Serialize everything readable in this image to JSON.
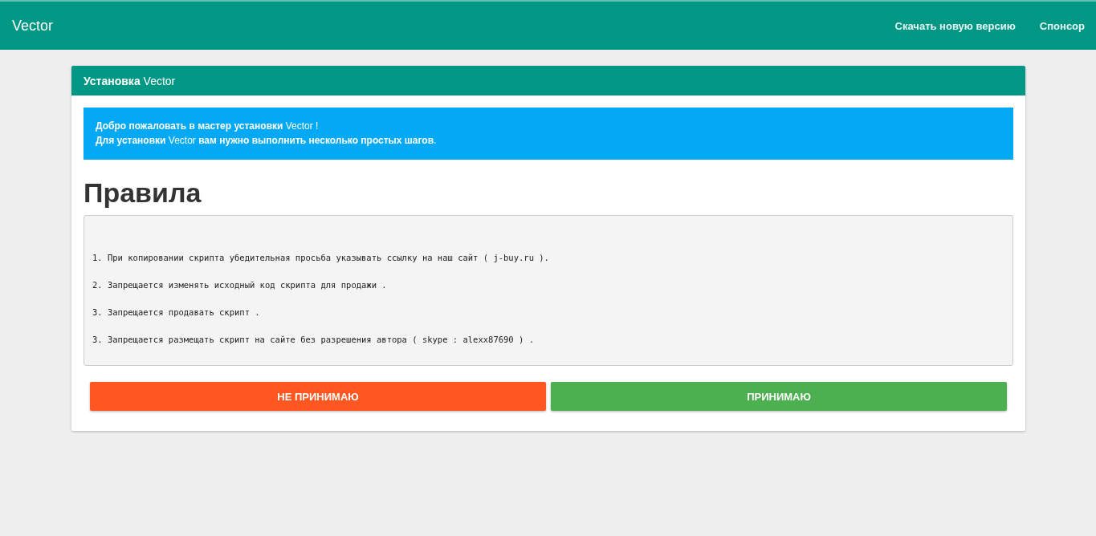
{
  "navbar": {
    "brand": "Vector",
    "links": [
      "Скачать новую версию",
      "Спонсор"
    ]
  },
  "panel": {
    "title": "**Установка** Vector",
    "alert": [
      "**Добро пожаловать в мастер установки** Vector !",
      "**Для установки** Vector **вам нужно выполнить несколько простых шагов**."
    ],
    "heading": "Правила",
    "rules": [
      "1. При копировании скрипта убедительная просьба указывать ссылку на наш сайт ( j-buy.ru ).",
      "2. Запрещается изменять исходный код скрипта для продажи .",
      "3. Запрещается продавать скрипт .",
      "3. Запрещается размещать скрипт на сайте без разрешения автора ( skype : alexx87690 ) ."
    ],
    "buttons": [
      {
        "label": "НЕ ПРИНИМАЮ",
        "kind": "decline"
      },
      {
        "label": "ПРИНИМАЮ",
        "kind": "accept"
      }
    ]
  }
}
